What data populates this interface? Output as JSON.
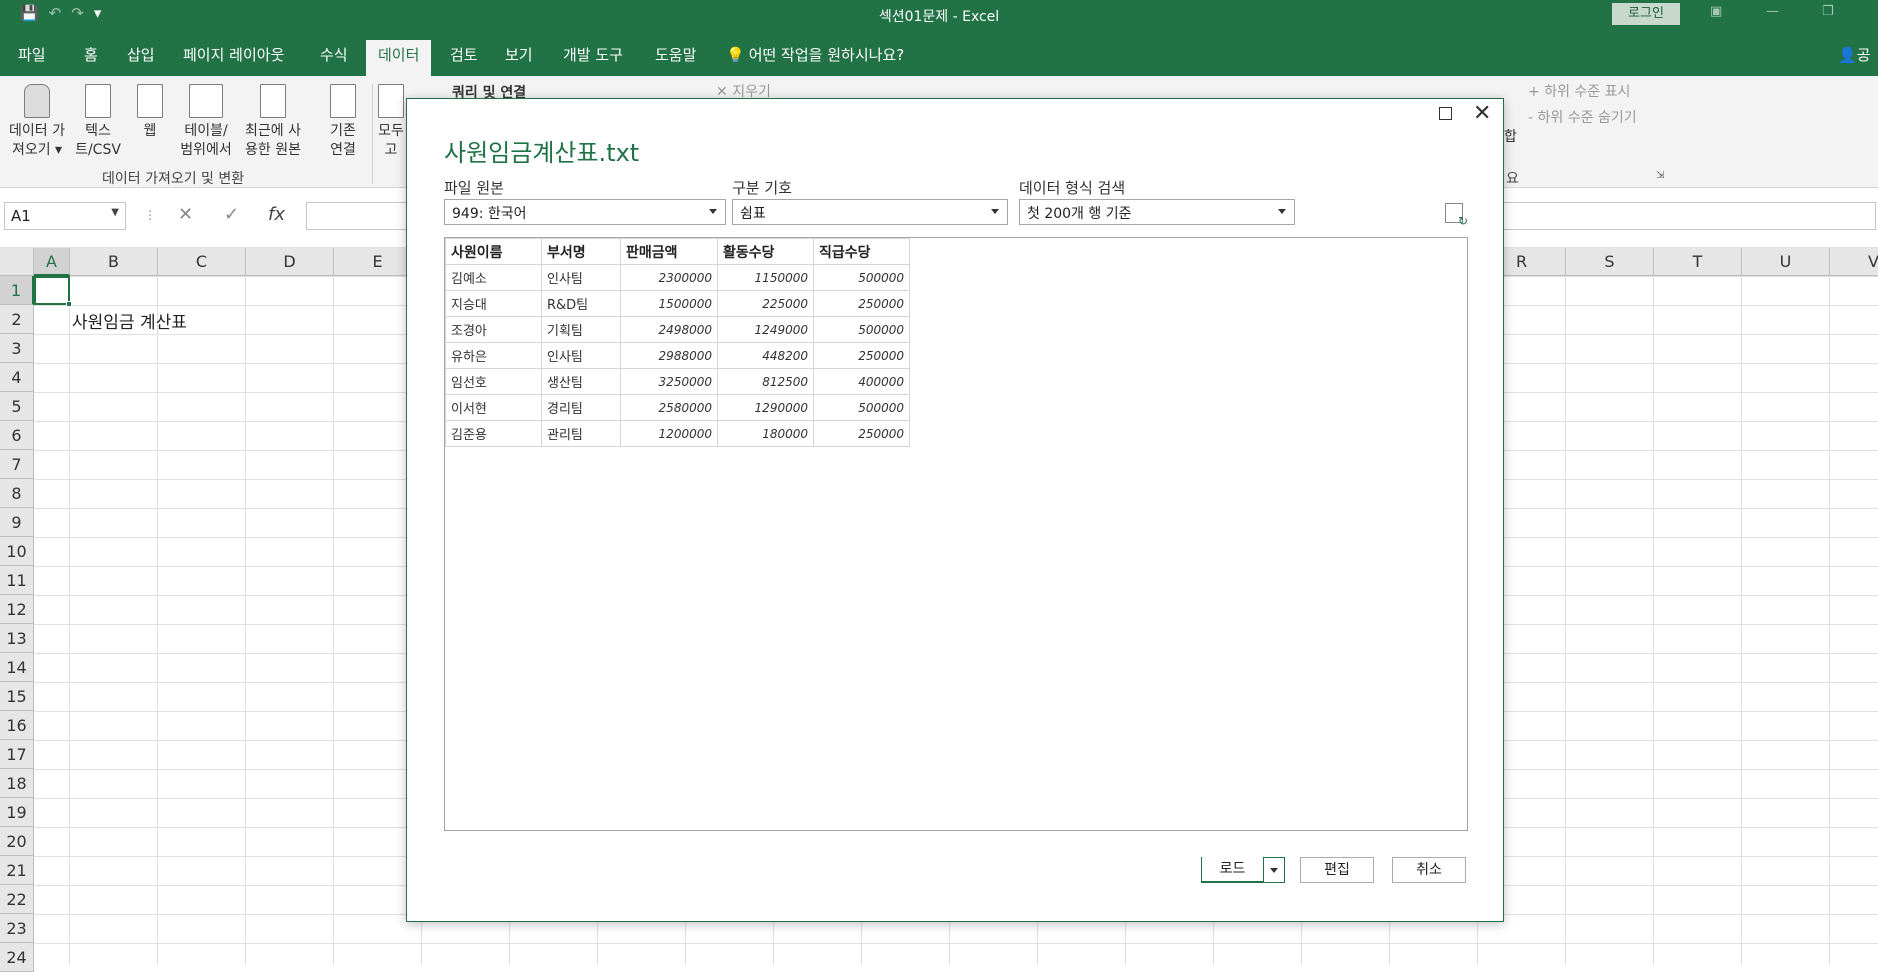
{
  "titlebar": {
    "title": "섹션01문제  -  Excel",
    "login": "로그인",
    "qat": {
      "save_icon": "save-icon",
      "undo_icon": "undo-icon",
      "redo_icon": "redo-icon"
    }
  },
  "menu": {
    "tabs": [
      "파일",
      "홈",
      "삽입",
      "페이지 레이아웃",
      "수식",
      "데이터",
      "검토",
      "보기",
      "개발 도구",
      "도움말"
    ],
    "active": "데이터",
    "tell_me": "어떤 작업을 원하시나요?",
    "share": "공"
  },
  "ribbon": {
    "get_data": [
      "데이터 가",
      "져오기"
    ],
    "text_csv": [
      "텍스",
      "트/CSV"
    ],
    "web": "웹",
    "from_table": [
      "테이블/",
      "범위에서"
    ],
    "recent": [
      "최근에 사",
      "용한 원본"
    ],
    "existing": [
      "기존",
      "연결"
    ],
    "refresh_all": [
      "모두",
      "고"
    ],
    "group_label": "데이터 가져오기 및 변환",
    "queries": "쿼리 및 연결",
    "clear": "지우기",
    "show_detail": "하위 수준 표시",
    "hide_detail": "하위 수준 숨기기",
    "group_partial": "합",
    "outline_label": "요"
  },
  "formula_bar": {
    "name_box": "A1",
    "fx": "fx"
  },
  "grid": {
    "columns": [
      "A",
      "B",
      "C",
      "D",
      "E",
      "",
      "",
      "",
      "",
      "",
      "",
      "",
      "",
      "",
      "",
      "",
      "",
      "R",
      "S",
      "T",
      "U",
      "V"
    ],
    "rows": [
      "1",
      "2",
      "3",
      "4",
      "5",
      "6",
      "7",
      "8",
      "9",
      "10",
      "11",
      "12",
      "13",
      "14",
      "15",
      "16",
      "17",
      "18",
      "19",
      "20",
      "21",
      "22",
      "23",
      "24"
    ],
    "b2": "사원임금 계산표"
  },
  "dialog": {
    "title": "사원임금계산표.txt",
    "file_origin_label": "파일 원본",
    "file_origin_value": "949: 한국어",
    "delimiter_label": "구분 기호",
    "delimiter_value": "쉼표",
    "detection_label": "데이터 형식 검색",
    "detection_value": "첫 200개 행 기준",
    "headers": [
      "사원이름",
      "부서명",
      "판매금액",
      "활동수당",
      "직급수당"
    ],
    "rows": [
      [
        "김예소",
        "인사팀",
        "2300000",
        "1150000",
        "500000"
      ],
      [
        "지승대",
        "R&D팀",
        "1500000",
        "225000",
        "250000"
      ],
      [
        "조경아",
        "기획팀",
        "2498000",
        "1249000",
        "500000"
      ],
      [
        "유하은",
        "인사팀",
        "2988000",
        "448200",
        "250000"
      ],
      [
        "임선호",
        "생산팀",
        "3250000",
        "812500",
        "400000"
      ],
      [
        "이서현",
        "경리팀",
        "2580000",
        "1290000",
        "500000"
      ],
      [
        "김준용",
        "관리팀",
        "1200000",
        "180000",
        "250000"
      ]
    ],
    "load": "로드",
    "edit": "편집",
    "cancel": "취소"
  }
}
